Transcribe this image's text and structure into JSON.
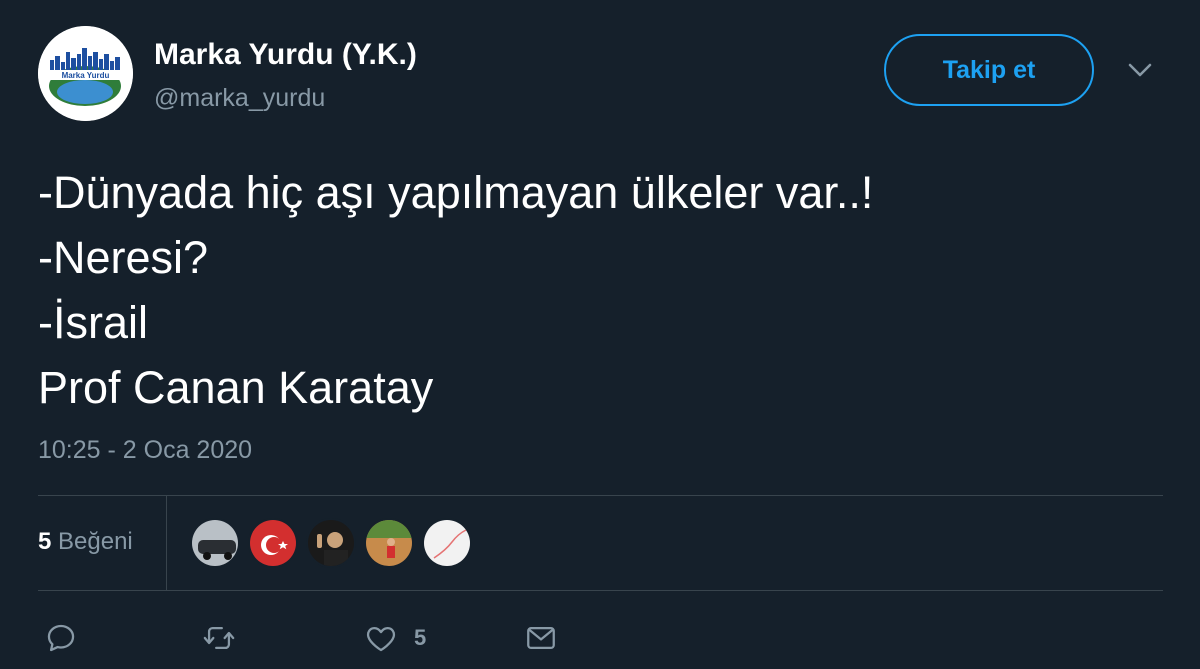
{
  "account": {
    "name": "Marka Yurdu (Y.K.)",
    "handle": "@marka_yurdu",
    "avatar_text": "Marka Yurdu",
    "follow_label": "Takip et"
  },
  "tweet": {
    "lines": [
      "-Dünyada hiç aşı yapılmayan ülkeler var..!",
      "-Neresi?",
      "-İsrail",
      "Prof Canan Karatay"
    ],
    "timestamp": "10:25 - 2 Oca 2020"
  },
  "likes": {
    "count": "5",
    "label": "Beğeni"
  },
  "actions": {
    "like_count": "5"
  },
  "colors": {
    "background": "#15202b",
    "accent": "#1da1f2",
    "secondary_text": "#8899a6",
    "divider": "#38444d"
  },
  "icons": [
    "reply-icon",
    "retweet-icon",
    "heart-icon",
    "dm-icon",
    "chevron-down-icon"
  ]
}
